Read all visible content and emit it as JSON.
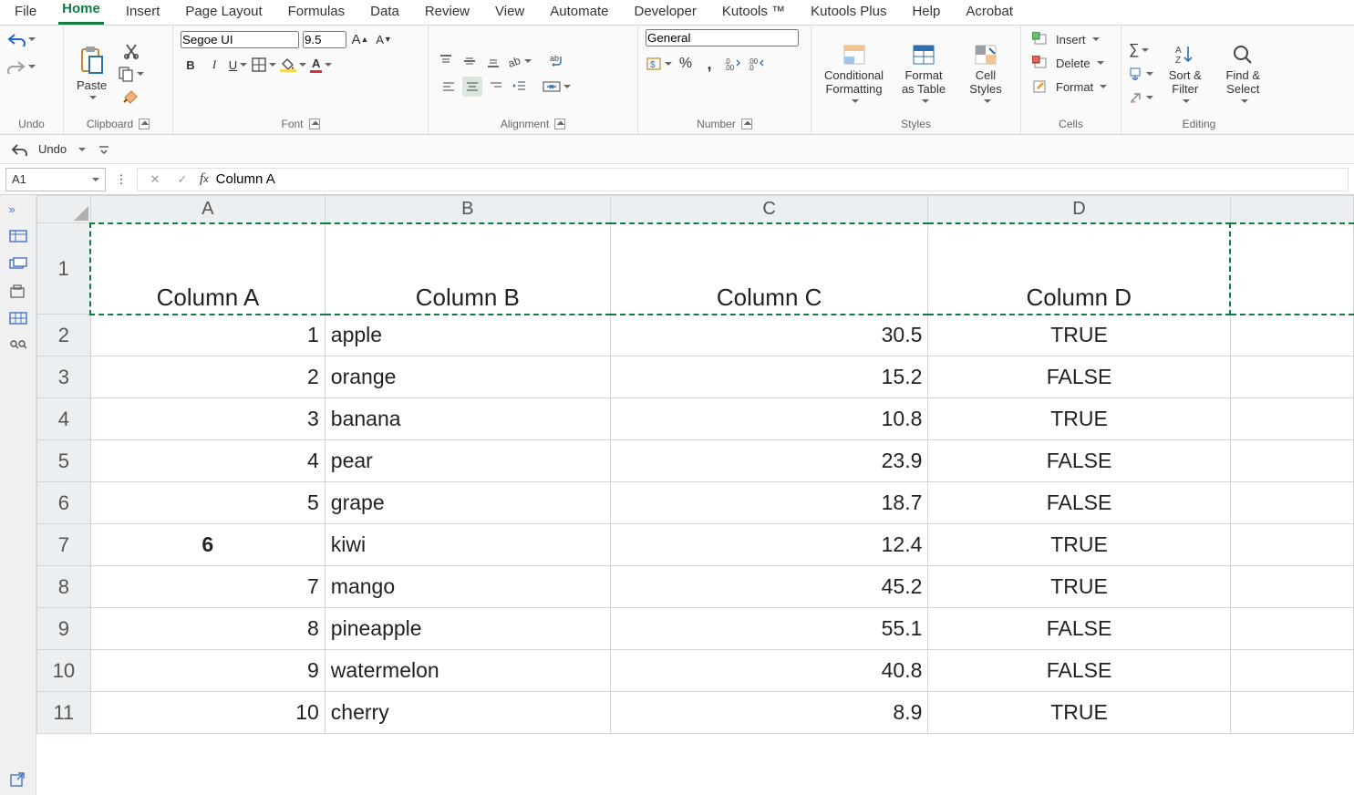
{
  "tabs": [
    "File",
    "Home",
    "Insert",
    "Page Layout",
    "Formulas",
    "Data",
    "Review",
    "View",
    "Automate",
    "Developer",
    "Kutools ™",
    "Kutools Plus",
    "Help",
    "Acrobat"
  ],
  "active_tab": "Home",
  "ribbon": {
    "undo_label": "Undo",
    "clipboard_label": "Clipboard",
    "paste_label": "Paste",
    "font_label": "Font",
    "font_name": "Segoe UI",
    "font_size": "9.5",
    "alignment_label": "Alignment",
    "number_label": "Number",
    "number_format": "General",
    "styles_label": "Styles",
    "cond_fmt": "Conditional Formatting",
    "fmt_table": "Format as Table",
    "cell_styles": "Cell Styles",
    "cells_label": "Cells",
    "insert": "Insert",
    "delete": "Delete",
    "format": "Format",
    "editing_label": "Editing",
    "sort_filter": "Sort & Filter",
    "find_select": "Find & Select"
  },
  "qat": {
    "undo": "Undo"
  },
  "namebox": "A1",
  "formula": "Column A",
  "columns": [
    "A",
    "B",
    "C",
    "D"
  ],
  "rows": [
    "1",
    "2",
    "3",
    "4",
    "5",
    "6",
    "7",
    "8",
    "9",
    "10",
    "11"
  ],
  "data": {
    "headers": [
      "Column A",
      "Column B",
      "Column C",
      "Column D"
    ],
    "body": [
      {
        "a": "1",
        "b": "apple",
        "c": "30.5",
        "d": "TRUE"
      },
      {
        "a": "2",
        "b": "orange",
        "c": "15.2",
        "d": "FALSE"
      },
      {
        "a": "3",
        "b": "banana",
        "c": "10.8",
        "d": "TRUE"
      },
      {
        "a": "4",
        "b": "pear",
        "c": "23.9",
        "d": "FALSE"
      },
      {
        "a": "5",
        "b": "grape",
        "c": "18.7",
        "d": "FALSE"
      },
      {
        "a": "6",
        "b": "kiwi",
        "c": "12.4",
        "d": "TRUE",
        "a_bold": true
      },
      {
        "a": "7",
        "b": "mango",
        "c": "45.2",
        "d": "TRUE"
      },
      {
        "a": "8",
        "b": "pineapple",
        "c": "55.1",
        "d": "FALSE"
      },
      {
        "a": "9",
        "b": "watermelon",
        "c": "40.8",
        "d": "FALSE"
      },
      {
        "a": "10",
        "b": "cherry",
        "c": "8.9",
        "d": "TRUE"
      }
    ]
  }
}
